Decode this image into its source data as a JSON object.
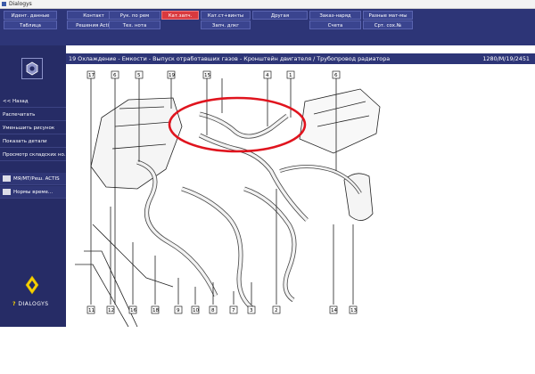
{
  "window": {
    "title": "Dialogys"
  },
  "menu": {
    "row1": [
      {
        "label": "Идент. данные",
        "active": false
      },
      {
        "label": "Контакт",
        "active": false
      },
      {
        "label": "Рук. по рем",
        "active": false
      },
      {
        "label": "Кат.запч.",
        "active": true
      },
      {
        "label": "Кат.ст+винты",
        "active": false
      },
      {
        "label": "Другая",
        "active": false
      },
      {
        "label": "Заказ-наряд",
        "active": false
      },
      {
        "label": "Разные мат-мы",
        "active": false
      }
    ],
    "row2": [
      {
        "label": "Таблица"
      },
      {
        "label": "Решения Actis"
      },
      {
        "label": "Тех. нота"
      },
      {
        "label": "Запч. длкг"
      },
      {
        "label": "Счета"
      },
      {
        "label": "Срт. сох.№"
      }
    ]
  },
  "sidebar": {
    "back": "<< Назад",
    "print": "Распечатать",
    "shrink": "Уменьшить рисунок",
    "show_details": "Показать детали",
    "stock_view": "Просмотр складских но...",
    "actis": "МЯ/МТ/Реш. ACTIS",
    "norms": "Нормы време...",
    "brand": "DIALOGYS"
  },
  "header": {
    "breadcrumb": "19 Охлаждение - Емкости - Выпуск отработавших газов - Кронштейн двигателя / Трубопровод радиатора",
    "reference": "1280/M/19/2451"
  },
  "diagram": {
    "callouts": [
      "17",
      "6",
      "5",
      "19",
      "15",
      "4",
      "1",
      "6",
      "11",
      "12",
      "16",
      "18",
      "9",
      "10",
      "8",
      "7",
      "3",
      "2",
      "14",
      "13"
    ],
    "highlight_color": "#e0141e"
  },
  "colors": {
    "menu_bg": "#2d3577",
    "active": "#d9393e"
  }
}
